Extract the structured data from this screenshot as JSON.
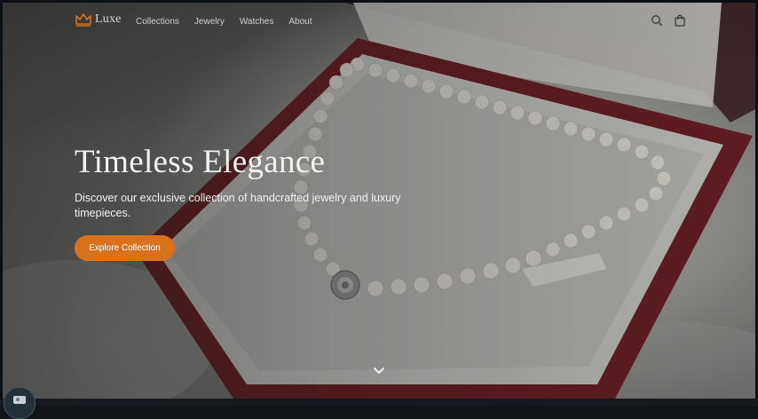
{
  "brand": {
    "name": "Luxe",
    "logo_icon": "crown-icon",
    "accent_color": "#d8711c"
  },
  "nav": {
    "links": [
      {
        "label": "Collections"
      },
      {
        "label": "Jewelry"
      },
      {
        "label": "Watches"
      },
      {
        "label": "About"
      }
    ],
    "icons": [
      "search-icon",
      "shopping-bag-icon"
    ]
  },
  "hero": {
    "title": "Timeless Elegance",
    "subtitle": "Discover our exclusive collection of handcrafted jewelry and luxury timepieces.",
    "cta_label": "Explore Collection",
    "background": "pearl necklace in red jewelry box on white fur",
    "scroll_icon": "chevron-down-icon"
  }
}
